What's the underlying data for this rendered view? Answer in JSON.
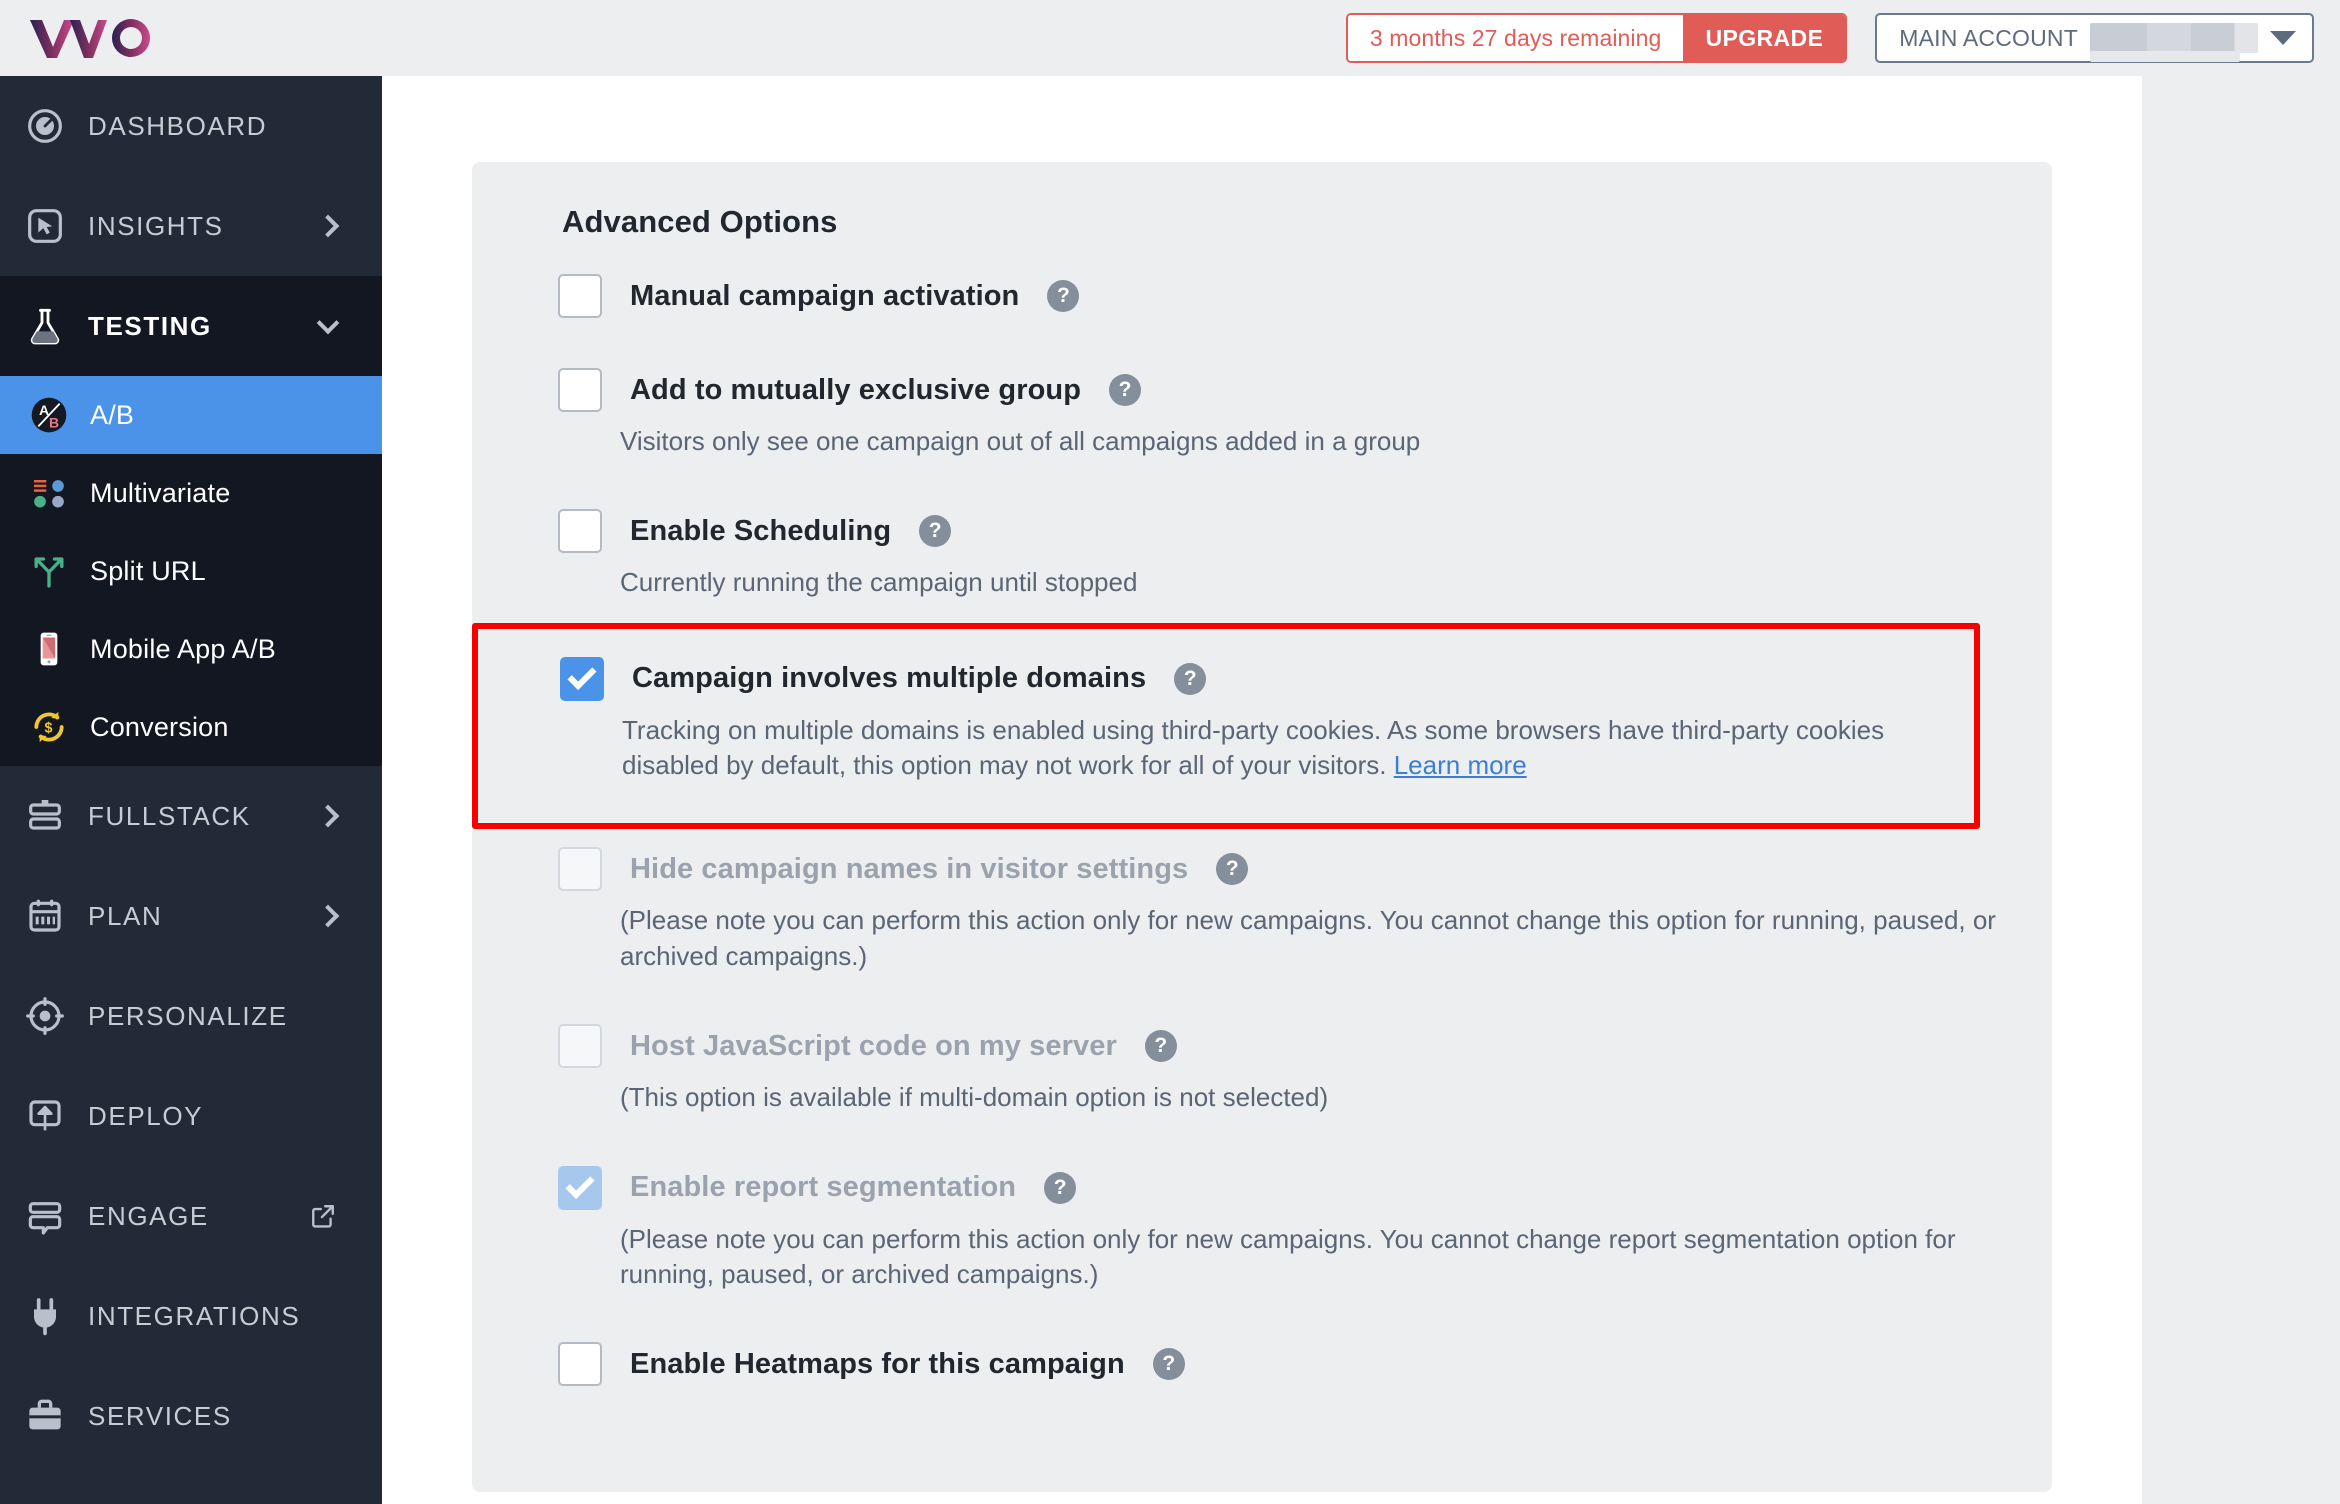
{
  "header": {
    "logo_alt": "VWO",
    "trial_text": "3 months 27 days remaining",
    "upgrade_label": "UPGRADE",
    "account_label": "MAIN ACCOUNT"
  },
  "sidebar": {
    "items": [
      {
        "label": "DASHBOARD",
        "icon": "dashboard-icon",
        "chevron": "none"
      },
      {
        "label": "INSIGHTS",
        "icon": "insights-icon",
        "chevron": "right"
      },
      {
        "label": "TESTING",
        "icon": "flask-icon",
        "chevron": "down"
      },
      {
        "label": "FULLSTACK",
        "icon": "fullstack-icon",
        "chevron": "right"
      },
      {
        "label": "PLAN",
        "icon": "calendar-icon",
        "chevron": "right"
      },
      {
        "label": "PERSONALIZE",
        "icon": "target-icon",
        "chevron": "none"
      },
      {
        "label": "DEPLOY",
        "icon": "deploy-icon",
        "chevron": "none"
      },
      {
        "label": "ENGAGE",
        "icon": "engage-icon",
        "chevron": "external"
      },
      {
        "label": "INTEGRATIONS",
        "icon": "plug-icon",
        "chevron": "none"
      },
      {
        "label": "SERVICES",
        "icon": "briefcase-icon",
        "chevron": "none"
      }
    ],
    "testing_subitems": [
      {
        "label": "A/B",
        "icon": "ab-test-icon",
        "active": true
      },
      {
        "label": "Multivariate",
        "icon": "multivariate-icon",
        "active": false
      },
      {
        "label": "Split URL",
        "icon": "split-url-icon",
        "active": false
      },
      {
        "label": "Mobile App A/B",
        "icon": "mobile-phone-icon",
        "active": false
      },
      {
        "label": "Conversion",
        "icon": "conversion-icon",
        "active": false
      }
    ]
  },
  "panel": {
    "title": "Advanced Options",
    "options": [
      {
        "label": "Manual campaign activation",
        "checked": false,
        "disabled": false,
        "description": ""
      },
      {
        "label": "Add to mutually exclusive group",
        "checked": false,
        "disabled": false,
        "description": "Visitors only see one campaign out of all campaigns added in a group"
      },
      {
        "label": "Enable Scheduling",
        "checked": false,
        "disabled": false,
        "description": "Currently running the campaign until stopped"
      },
      {
        "label": "Campaign involves multiple domains",
        "checked": true,
        "disabled": false,
        "highlighted": true,
        "description": "Tracking on multiple domains is enabled using third-party cookies. As some browsers have third-party cookies disabled by default, this option may not work for all of your visitors.",
        "link_label": "Learn more"
      },
      {
        "label": "Hide campaign names in visitor settings",
        "checked": false,
        "disabled": true,
        "description": "(Please note you can perform this action only for new campaigns. You cannot change this option for running, paused, or archived campaigns.)"
      },
      {
        "label": "Host JavaScript code on my server",
        "checked": false,
        "disabled": true,
        "description": "(This option is available if multi-domain option is not selected)"
      },
      {
        "label": "Enable report segmentation",
        "checked": true,
        "disabled": true,
        "description": "(Please note you can perform this action only for new campaigns. You cannot change report segmentation option for running, paused, or archived campaigns.)"
      },
      {
        "label": "Enable Heatmaps for this campaign",
        "checked": false,
        "disabled": false,
        "description": ""
      }
    ],
    "help_glyph": "?"
  },
  "colors": {
    "accent_blue": "#4a93e8",
    "highlight_red": "#f70000",
    "upgrade_red": "#e05c57",
    "sidebar_bg": "#232a37",
    "sidebar_testing_bg": "#121722",
    "panel_bg": "#eceef0",
    "link_blue": "#3b7fd4"
  }
}
